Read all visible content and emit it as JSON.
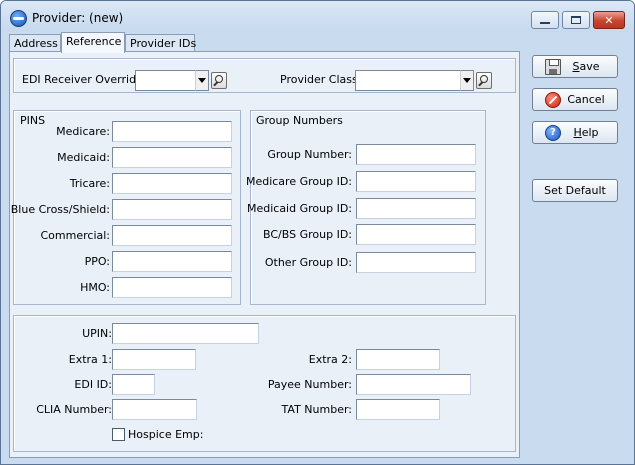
{
  "window": {
    "title": "Provider: (new)"
  },
  "tabs": [
    {
      "label": "Address"
    },
    {
      "label": "Reference"
    },
    {
      "label": "Provider IDs"
    }
  ],
  "top": {
    "edi_override_label": "EDI Receiver Override:",
    "edi_override_value": "",
    "provider_class_label": "Provider Class:",
    "provider_class_value": ""
  },
  "pins": {
    "caption": "PINS",
    "fields": [
      {
        "label": "Medicare:",
        "value": ""
      },
      {
        "label": "Medicaid:",
        "value": ""
      },
      {
        "label": "Tricare:",
        "value": ""
      },
      {
        "label": "Blue Cross/Shield:",
        "value": ""
      },
      {
        "label": "Commercial:",
        "value": ""
      },
      {
        "label": "PPO:",
        "value": ""
      },
      {
        "label": "HMO:",
        "value": ""
      }
    ]
  },
  "group_numbers": {
    "caption": "Group Numbers",
    "fields": [
      {
        "label": "Group Number:",
        "value": ""
      },
      {
        "label": "Medicare Group ID:",
        "value": ""
      },
      {
        "label": "Medicaid Group ID:",
        "value": ""
      },
      {
        "label": "BC/BS Group ID:",
        "value": ""
      },
      {
        "label": "Other Group ID:",
        "value": ""
      }
    ]
  },
  "bottom": {
    "upin_label": "UPIN:",
    "extra1_label": "Extra 1:",
    "extra2_label": "Extra 2:",
    "edi_id_label": "EDI ID:",
    "payee_number_label": "Payee Number:",
    "clia_number_label": "CLIA Number:",
    "tat_number_label": "TAT Number:",
    "hospice_label": "Hospice Emp:",
    "hospice_checked": false
  },
  "buttons": {
    "save": {
      "label": "Save",
      "icon": "save-icon"
    },
    "cancel": {
      "label": "Cancel",
      "icon": "cancel-icon"
    },
    "help": {
      "label": "Help",
      "icon": "help-icon"
    },
    "set_default": {
      "label": "Set Default"
    }
  }
}
